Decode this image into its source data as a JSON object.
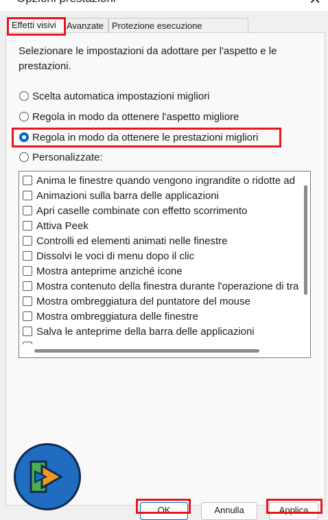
{
  "window": {
    "title": "Opzioni prestazioni",
    "close_glyph": "✕"
  },
  "tabs": [
    {
      "label": "Effetti visivi",
      "active": true
    },
    {
      "label": "Avanzate",
      "active": false
    },
    {
      "label": "Protezione esecuzione programmi",
      "active": false
    }
  ],
  "description": "Selezionare le impostazioni da adottare per l'aspetto e le prestazioni.",
  "radio_options": [
    {
      "label": "Scelta automatica impostazioni migliori",
      "checked": false
    },
    {
      "label": "Regola in modo da ottenere l'aspetto migliore",
      "checked": false
    },
    {
      "label": "Regola in modo da ottenere le prestazioni migliori",
      "checked": true
    },
    {
      "label": "Personalizzate:",
      "checked": false
    }
  ],
  "effects": [
    {
      "label": "Anima le finestre quando vengono ingrandite o ridotte ad icona",
      "checked": false
    },
    {
      "label": "Animazioni sulla barra delle applicazioni",
      "checked": false
    },
    {
      "label": "Apri caselle combinate con effetto scorrimento",
      "checked": false
    },
    {
      "label": "Attiva Peek",
      "checked": false
    },
    {
      "label": "Controlli ed elementi animati nelle finestre",
      "checked": false
    },
    {
      "label": "Dissolvi le voci di menu dopo il clic",
      "checked": false
    },
    {
      "label": "Mostra anteprime anziché icone",
      "checked": false
    },
    {
      "label": "Mostra contenuto della finestra durante l'operazione di trascinamento",
      "checked": false
    },
    {
      "label": "Mostra ombreggiatura del puntatore del mouse",
      "checked": false
    },
    {
      "label": "Mostra ombreggiatura delle finestre",
      "checked": false
    },
    {
      "label": "Salva le anteprime della barra delle applicazioni",
      "checked": false
    },
    {
      "label": "",
      "checked": false
    }
  ],
  "buttons": {
    "ok": "OK",
    "cancel": "Annulla",
    "apply": "Applica"
  },
  "colors": {
    "accent": "#0067c0",
    "highlight": "#e8141e",
    "logo_blue": "#1f6cc1",
    "logo_orange": "#f39a1e",
    "logo_green": "#4caf50"
  }
}
